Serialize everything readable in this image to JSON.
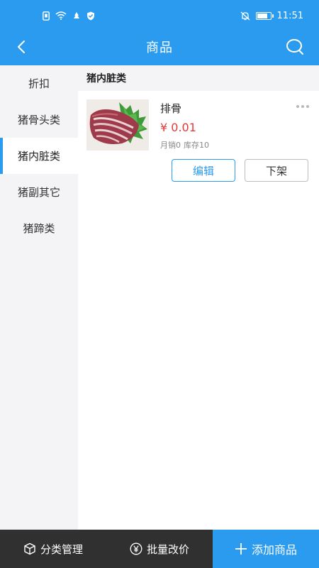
{
  "status_bar": {
    "time": "11:51",
    "battery_level": 0.7,
    "icons": [
      "sim-icon",
      "wifi-icon",
      "notification-icon",
      "shield-icon",
      "mute-icon",
      "battery-icon"
    ]
  },
  "header": {
    "title": "商品",
    "back_icon": "chevron-left-icon",
    "search_icon": "search-icon"
  },
  "sidebar": {
    "items": [
      {
        "label": "折扣"
      },
      {
        "label": "猪骨头类"
      },
      {
        "label": "猪内脏类"
      },
      {
        "label": "猪副其它"
      },
      {
        "label": "猪蹄类"
      }
    ],
    "active_index": 2
  },
  "content": {
    "category_title": "猪内脏类",
    "products": [
      {
        "name": "排骨",
        "price": "¥ 0.01",
        "monthly_sales": "月销0",
        "stock": "库存10",
        "edit_label": "编辑",
        "offshelf_label": "下架"
      }
    ]
  },
  "bottom_bar": {
    "category_manage": "分类管理",
    "bulk_price": "批量改价",
    "add_product": "添加商品"
  },
  "colors": {
    "primary": "#2b9bf0",
    "price": "#e03a3a",
    "dark_bar": "#303030"
  }
}
